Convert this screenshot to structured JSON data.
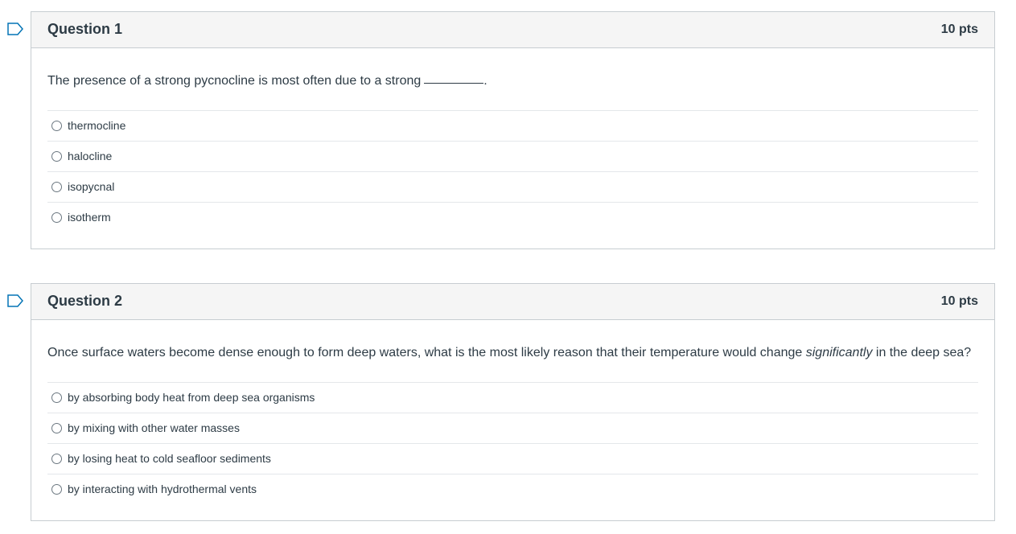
{
  "questions": [
    {
      "title": "Question 1",
      "points": "10 pts",
      "text": "The presence of a strong pycnocline is most often due to a strong",
      "text_suffix": ".",
      "answers": [
        "thermocline",
        "halocline",
        "isopycnal",
        "isotherm"
      ]
    },
    {
      "title": "Question 2",
      "points": "10 pts",
      "text_before": "Once surface waters become dense enough to form deep waters, what is the most likely reason that their temperature would change ",
      "text_emphasis": "significantly",
      "text_after": " in the deep sea?",
      "answers": [
        "by absorbing body heat from deep sea organisms",
        "by mixing with other water masses",
        "by losing heat to cold seafloor sediments",
        "by interacting with hydrothermal vents"
      ]
    }
  ],
  "icons": {
    "flag": "bookmark-flag-icon"
  },
  "colors": {
    "flag": "#0374b5",
    "header_bg": "#f5f5f5",
    "border": "#c7cdd1",
    "text": "#2d3b45"
  }
}
